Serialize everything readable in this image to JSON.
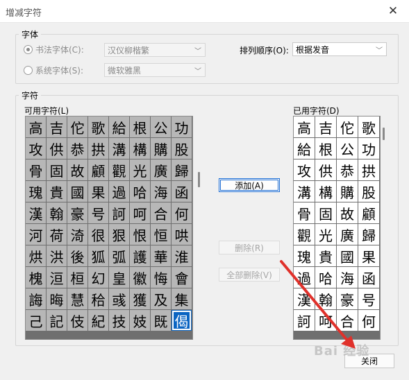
{
  "window": {
    "title": "增减字符",
    "close_glyph": "✕"
  },
  "font_group": {
    "legend": "字体",
    "calligraphy_radio": "书法字体(C):",
    "system_radio": "系统字体(S):",
    "calligraphy_value": "汉仪柳楷繁",
    "system_value": "微软雅黑",
    "sort_label": "排列顺序(O):",
    "sort_value": "根据发音"
  },
  "char_group": {
    "legend": "字符",
    "available_label": "可用字符(L)",
    "used_label": "已用字符(D)"
  },
  "available_chars": [
    [
      "高",
      "吉",
      "佗",
      "歌",
      "給",
      "根",
      "公",
      "功"
    ],
    [
      "攻",
      "供",
      "恭",
      "拱",
      "溝",
      "構",
      "購",
      "股"
    ],
    [
      "骨",
      "固",
      "故",
      "顧",
      "觀",
      "光",
      "廣",
      "歸"
    ],
    [
      "瑰",
      "貴",
      "國",
      "果",
      "過",
      "哈",
      "海",
      "函"
    ],
    [
      "漢",
      "翰",
      "豪",
      "号",
      "訶",
      "呵",
      "合",
      "何"
    ],
    [
      "河",
      "荷",
      "渏",
      "很",
      "狠",
      "恨",
      "恒",
      "哄"
    ],
    [
      "烘",
      "洪",
      "後",
      "狐",
      "弧",
      "護",
      "華",
      "淮"
    ],
    [
      "槐",
      "洹",
      "桓",
      "幻",
      "皇",
      "徽",
      "悔",
      "會"
    ],
    [
      "誨",
      "晦",
      "慧",
      "秴",
      "彧",
      "獲",
      "及",
      "集"
    ],
    [
      "己",
      "記",
      "伎",
      "紀",
      "技",
      "妓",
      "既",
      "偈"
    ]
  ],
  "selected_char": "偈",
  "used_chars": [
    [
      "高",
      "吉",
      "佗",
      "歌"
    ],
    [
      "給",
      "根",
      "公",
      "功"
    ],
    [
      "攻",
      "供",
      "恭",
      "拱"
    ],
    [
      "溝",
      "構",
      "購",
      "股"
    ],
    [
      "骨",
      "固",
      "故",
      "顧"
    ],
    [
      "觀",
      "光",
      "廣",
      "歸"
    ],
    [
      "瑰",
      "貴",
      "國",
      "果"
    ],
    [
      "過",
      "哈",
      "海",
      "函"
    ],
    [
      "漢",
      "翰",
      "豪",
      "号"
    ],
    [
      "訶",
      "呵",
      "合",
      "何"
    ]
  ],
  "buttons": {
    "add": "添加(A)",
    "delete": "删除(R)",
    "delete_all": "全部删除(V)",
    "close": "关闭"
  },
  "watermark": "Bai 经验",
  "colors": {
    "selection": "#0a64c2",
    "arrow": "#e0312b",
    "available_cell": "#b7b7b7"
  }
}
